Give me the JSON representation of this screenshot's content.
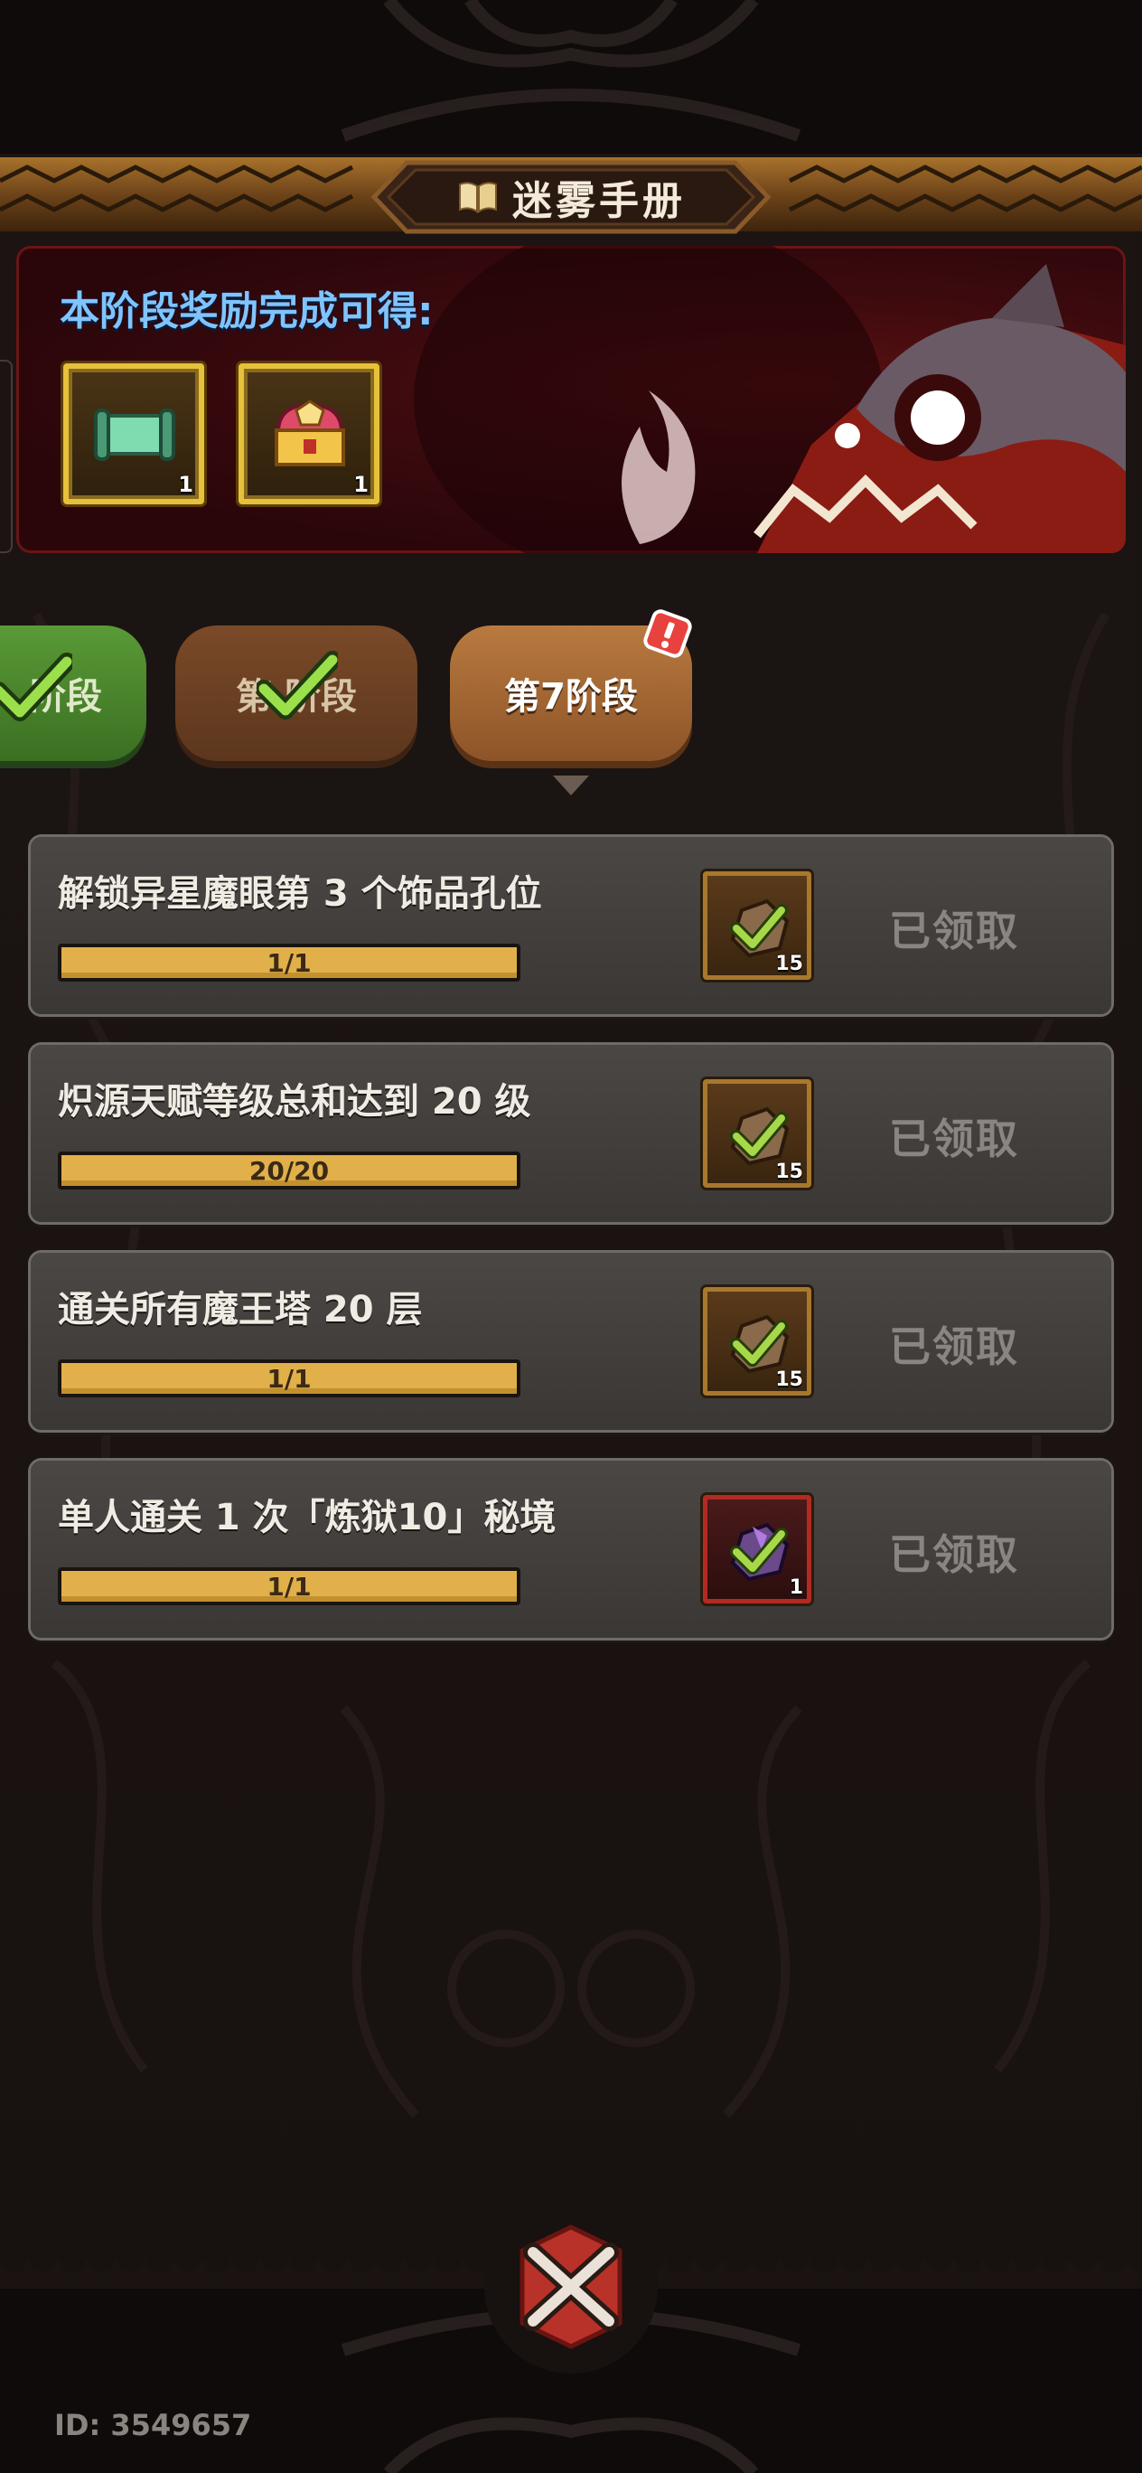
{
  "colors": {
    "accent_gold": "#e6c13b",
    "reward_title_blue": "#7fc4ff",
    "progress_fill": "#e2b04a",
    "claimed_gray": "#8a8580",
    "tab_active": "#b97a40",
    "tab_complete_green": "#5a9a36"
  },
  "header": {
    "title": "迷雾手册",
    "icon": "book-icon"
  },
  "reward_banner": {
    "title": "本阶段奖励完成可得:",
    "rewards": [
      {
        "icon": "scroll-icon",
        "count": "1"
      },
      {
        "icon": "treasure-chest-icon",
        "count": "1"
      }
    ]
  },
  "stage_tabs": [
    {
      "label": "阶段",
      "state": "completed",
      "icon": "check-icon"
    },
    {
      "label": "第 阶段",
      "state": "completed",
      "icon": "check-icon"
    },
    {
      "label": "第7阶段",
      "state": "active",
      "badge": "alert-badge"
    }
  ],
  "tasks": [
    {
      "title": "解锁异星魔眼第 3 个饰品孔位",
      "progress": "1/1",
      "progress_fraction": 1.0,
      "reward_icon": "ore-icon",
      "reward_count": "15",
      "status": "已领取"
    },
    {
      "title": "炽源天赋等级总和达到 20 级",
      "progress": "20/20",
      "progress_fraction": 1.0,
      "reward_icon": "ore-icon",
      "reward_count": "15",
      "status": "已领取"
    },
    {
      "title": "通关所有魔王塔 20 层",
      "progress": "1/1",
      "progress_fraction": 1.0,
      "reward_icon": "ore-icon",
      "reward_count": "15",
      "status": "已领取"
    },
    {
      "title": "单人通关 1 次「炼狱10」秘境",
      "progress": "1/1",
      "progress_fraction": 1.0,
      "reward_icon": "crystal-ore-icon",
      "reward_count": "1",
      "status": "已领取"
    }
  ],
  "footer": {
    "player_id": "ID: 3549657"
  }
}
